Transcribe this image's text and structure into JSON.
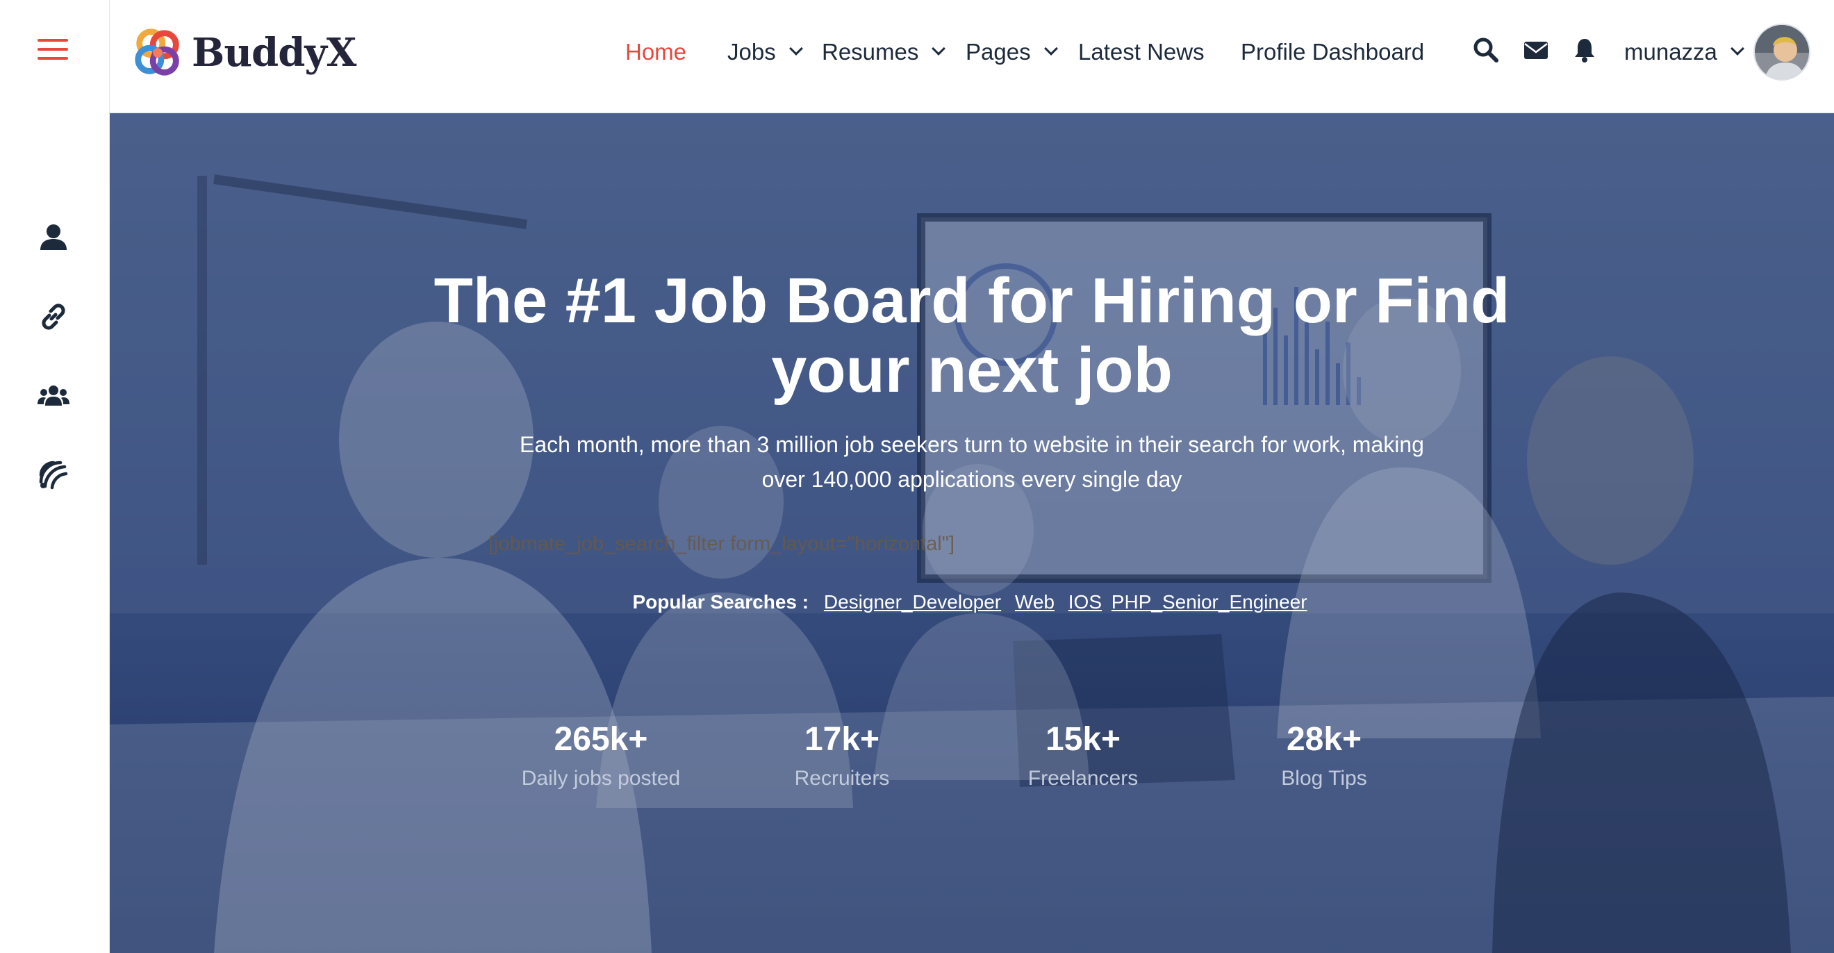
{
  "brand": {
    "name": "BuddyX",
    "logo_icon": "buddyx-logo-icon",
    "accent_color": "#e8473b",
    "text_color": "#1d2a3b"
  },
  "rail": {
    "menu_icon": "hamburger-menu-icon",
    "items": [
      {
        "icon": "user-icon"
      },
      {
        "icon": "link-icon"
      },
      {
        "icon": "users-group-icon"
      },
      {
        "icon": "activity-feed-icon"
      }
    ]
  },
  "nav": {
    "items": [
      {
        "label": "Home",
        "active": true
      },
      {
        "label": "Jobs",
        "dropdown": true
      },
      {
        "label": "Resumes",
        "dropdown": true
      },
      {
        "label": "Pages",
        "dropdown": true
      },
      {
        "label": "Latest News"
      },
      {
        "label": "Profile Dashboard"
      }
    ],
    "icons": [
      "search-icon",
      "envelope-icon",
      "bell-icon"
    ],
    "user": {
      "name": "munazza",
      "avatar_icon": "user-avatar"
    }
  },
  "hero": {
    "title_line1": "The #1 Job Board for Hiring or Find",
    "title_line2": "your next job",
    "subtitle_line1": "Each month, more than 3 million job seekers turn to website in their search for work, making",
    "subtitle_line2": "over 140,000 applications every single day",
    "shortcode": "[jobmate_job_search_filter form_layout=\"horizontal\"]",
    "popular_label": "Popular Searches :",
    "popular_links": [
      "Designer",
      "Developer",
      "Web",
      "IOS",
      "PHP",
      "Senior",
      "Engineer"
    ],
    "popular_display": [
      "Designer_Developer",
      "Web",
      "IOS",
      "PHP_Senior_Engineer"
    ],
    "stats": [
      {
        "value": "265k+",
        "label": "Daily jobs posted"
      },
      {
        "value": "17k+",
        "label": "Recruiters"
      },
      {
        "value": "15k+",
        "label": "Freelancers"
      },
      {
        "value": "28k+",
        "label": "Blog Tips"
      }
    ]
  }
}
